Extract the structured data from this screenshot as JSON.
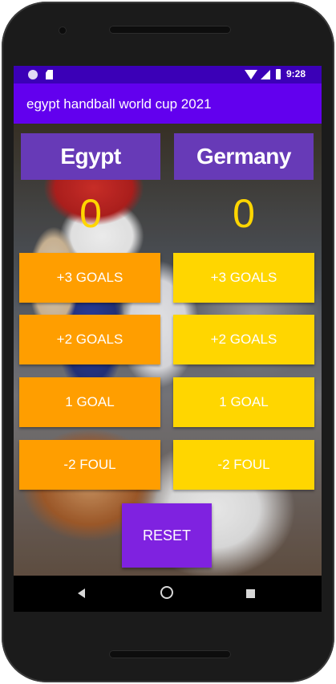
{
  "status_bar": {
    "time": "9:28"
  },
  "app_bar": {
    "title": "egypt handball world cup 2021"
  },
  "teams": {
    "team_a": {
      "name": "Egypt",
      "score": "0"
    },
    "team_b": {
      "name": "Germany",
      "score": "0"
    }
  },
  "buttons": {
    "team_a": [
      "+3 GOALS",
      "+2 GOALS",
      "1 GOAL",
      "-2 FOUL"
    ],
    "team_b": [
      "+3 GOALS",
      "+2 GOALS",
      "1 GOAL",
      "-2 FOUL"
    ],
    "reset": "RESET"
  },
  "colors": {
    "status_bar": "#3b00b7",
    "app_bar": "#6200ee",
    "team_header": "#673ab7",
    "team_a_button": "#ff9e00",
    "team_b_button": "#ffd600",
    "score": "#ffd600",
    "reset_button": "#7f22e0"
  },
  "icons": [
    "circle-notification-icon",
    "sd-card-icon",
    "wifi-icon",
    "cell-signal-icon",
    "battery-icon",
    "nav-back-icon",
    "nav-home-icon",
    "nav-recents-icon"
  ]
}
